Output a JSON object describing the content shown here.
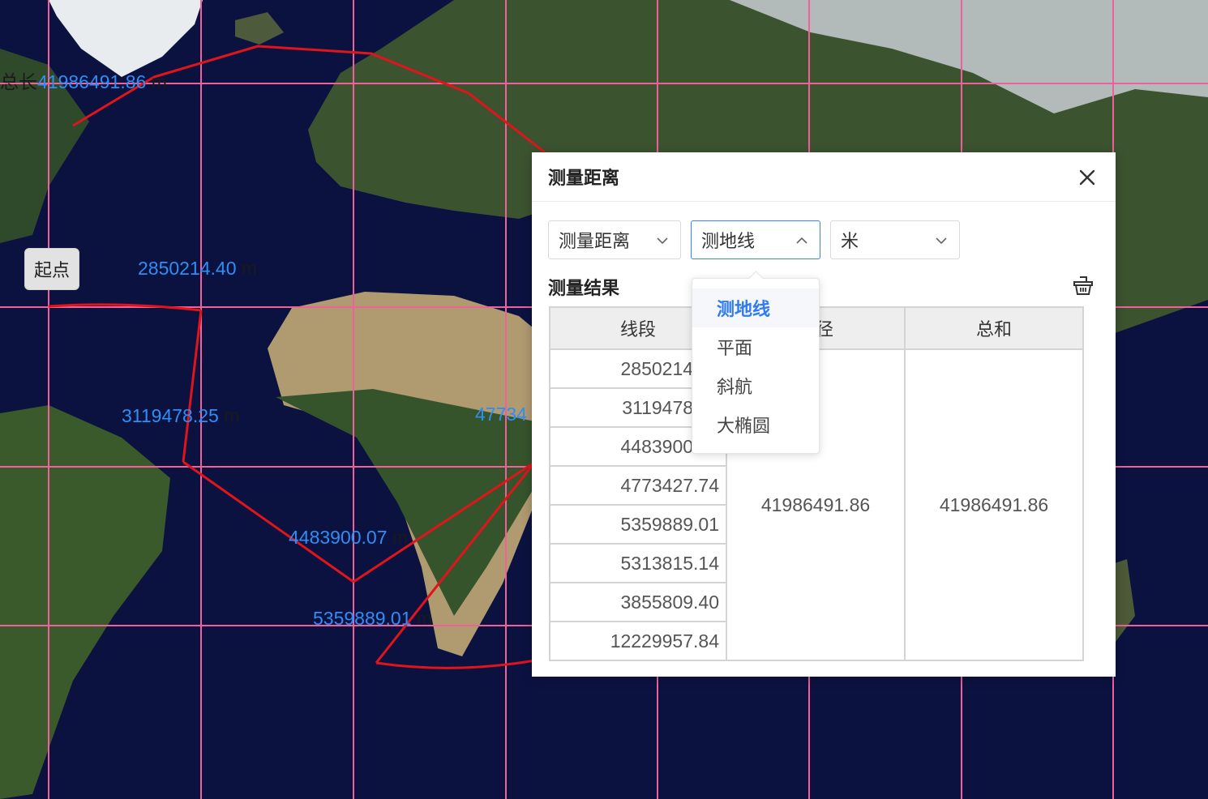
{
  "map": {
    "start_label": "起点",
    "total_label": "总长",
    "total_value": "41986491.86",
    "segment_labels": [
      {
        "value": "2850214.40",
        "unit": "m"
      },
      {
        "value": "3119478.25",
        "unit": "m"
      },
      {
        "value": "4483900.07",
        "unit": "m"
      },
      {
        "value": "5359889.01",
        "unit": "m"
      },
      {
        "value": "47734",
        "unit": ""
      }
    ],
    "colors": {
      "ocean": "#0b1240",
      "grid": "#f0609a",
      "route": "#e0141b",
      "label": "#2f8ef5"
    }
  },
  "panel": {
    "title": "测量距离",
    "close_icon": "close-icon",
    "selects": {
      "mode": "测量距离",
      "line_type": "测地线",
      "unit": "米"
    },
    "result_title": "测量结果",
    "clear_icon": "basket-icon",
    "table": {
      "headers": [
        "线段",
        "路径",
        "总和"
      ],
      "segments": [
        "2850214.40",
        "3119478.25",
        "4483900.07",
        "4773427.74",
        "5359889.01",
        "5313815.14",
        "3855809.40",
        "12229957.84"
      ],
      "path": "41986491.86",
      "total": "41986491.86"
    }
  },
  "dropdown": {
    "options": [
      "测地线",
      "平面",
      "斜航",
      "大椭圆"
    ],
    "selected": "测地线"
  },
  "accent_color": "#3b82f6"
}
